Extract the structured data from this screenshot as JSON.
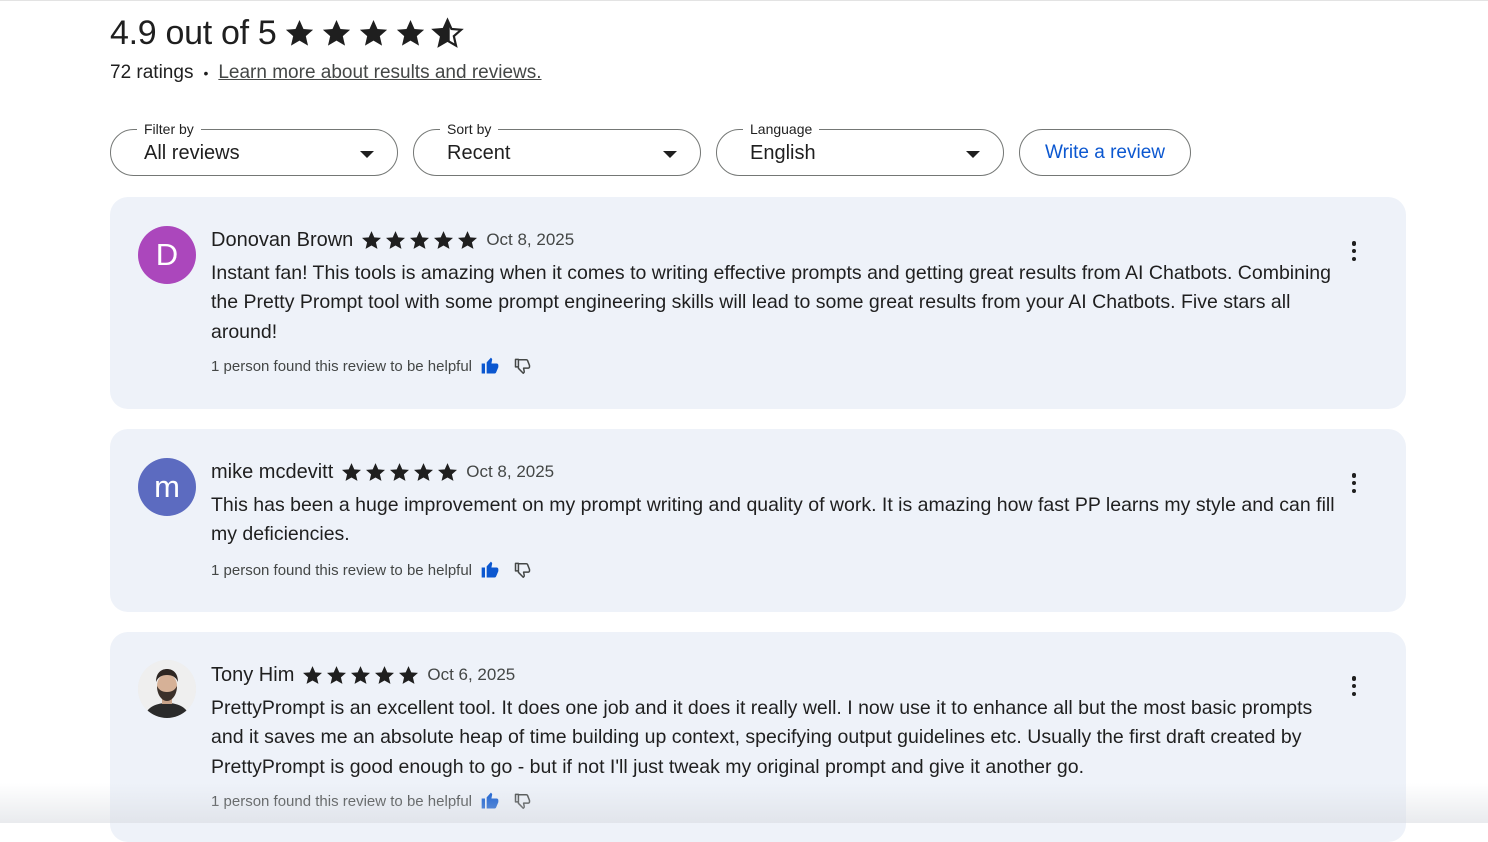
{
  "summary": {
    "rating_text": "4.9 out of 5",
    "stars": 4.9,
    "ratings_count": "72 ratings",
    "separator": "•",
    "learn_more": "Learn more about results and reviews."
  },
  "filters": {
    "filter_by": {
      "legend": "Filter by",
      "value": "All reviews"
    },
    "sort_by": {
      "legend": "Sort by",
      "value": "Recent"
    },
    "language": {
      "legend": "Language",
      "value": "English"
    },
    "write_review": "Write a review"
  },
  "reviews": [
    {
      "author": "Donovan Brown",
      "avatar_letter": "D",
      "avatar_color": "#ab47bc",
      "stars": 5,
      "date": "Oct 8, 2025",
      "text": "Instant fan! This tools is amazing when it comes to writing effective prompts and getting great results from AI Chatbots. Combining the Pretty Prompt tool with some prompt engineering skills will lead to some great results from your AI Chatbots. Five stars all around!",
      "helpful": "1 person found this review to be helpful"
    },
    {
      "author": "mike mcdevitt",
      "avatar_letter": "m",
      "avatar_color": "#5c6bc0",
      "stars": 5,
      "date": "Oct 8, 2025",
      "text": "This has been a huge improvement on my prompt writing and quality of work.  It is amazing how fast PP learns my style and can fill my deficiencies.",
      "helpful": "1 person found this review to be helpful"
    },
    {
      "author": "Tony Him",
      "avatar_letter": "",
      "avatar_color": "#e8e8e8",
      "stars": 5,
      "date": "Oct 6, 2025",
      "text": "PrettyPrompt is an excellent tool.  It does one job and it does it really well.  I now use it to enhance all but the most basic prompts and it saves me an absolute heap of time building up context, specifying output guidelines etc.  Usually the first draft created by PrettyPrompt is good enough to go - but if not I'll just tweak my original prompt and give it another go.",
      "helpful": "1 person found this review to be helpful"
    }
  ],
  "colors": {
    "accent": "#0b57d0",
    "card_bg": "#eef2f9",
    "star": "#1f1f1f"
  },
  "icons": {
    "star": "star-icon",
    "thumb_up": "thumb-up-icon",
    "thumb_down": "thumb-down-icon",
    "more": "more-vert-icon",
    "caret": "caret-down-icon"
  }
}
